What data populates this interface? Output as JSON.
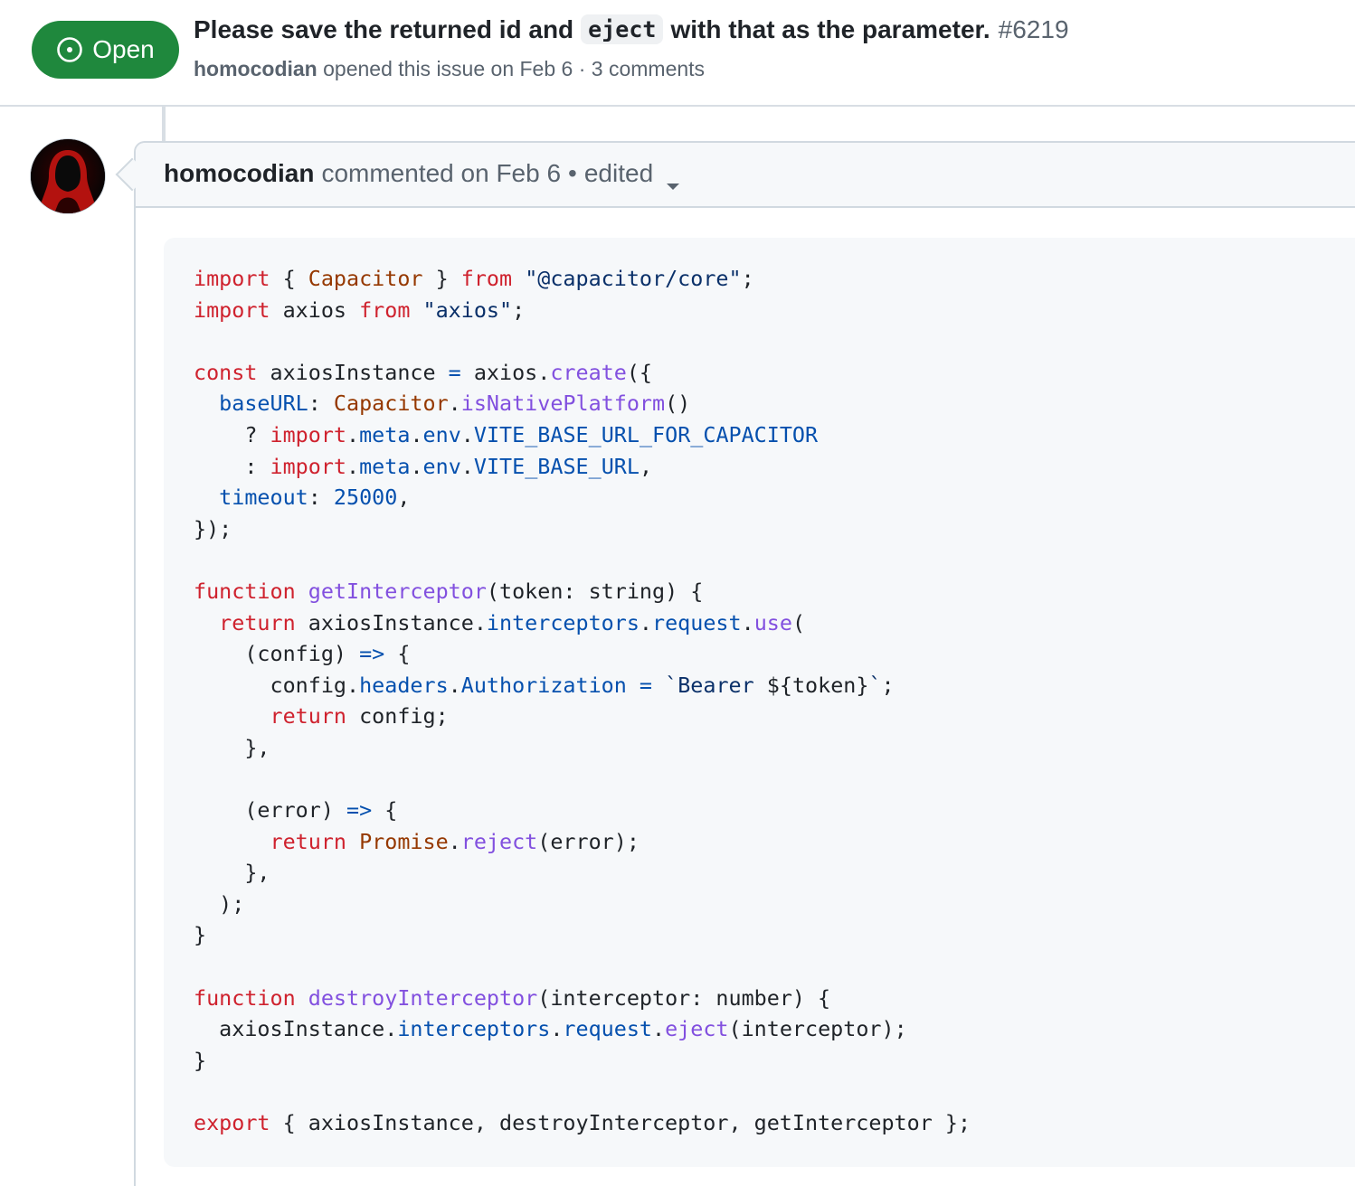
{
  "issue": {
    "state": "Open",
    "title_before": "Please save the returned id and",
    "title_code": "eject",
    "title_after": "with that as the parameter.",
    "number": "#6219",
    "author": "homocodian",
    "opened_text": "opened this issue on Feb 6",
    "separator": "·",
    "comments": "3 comments"
  },
  "comment": {
    "author": "homocodian",
    "commented_text": "commented on Feb 6",
    "bullet": "•",
    "edited": "edited"
  },
  "colors": {
    "open_green": "#1f883d",
    "keyword": "#cf222e",
    "class": "#953800",
    "string": "#0a3069",
    "function": "#8250df",
    "property": "#0550ae"
  },
  "code_lines": [
    [
      [
        "kw",
        "import"
      ],
      [
        "p",
        " { "
      ],
      [
        "cls",
        "Capacitor"
      ],
      [
        "p",
        " } "
      ],
      [
        "kw",
        "from"
      ],
      [
        "p",
        " "
      ],
      [
        "str",
        "\"@capacitor/core\""
      ],
      [
        "p",
        ";"
      ]
    ],
    [
      [
        "kw",
        "import"
      ],
      [
        "p",
        " axios "
      ],
      [
        "kw",
        "from"
      ],
      [
        "p",
        " "
      ],
      [
        "str",
        "\"axios\""
      ],
      [
        "p",
        ";"
      ]
    ],
    [],
    [
      [
        "kw",
        "const"
      ],
      [
        "p",
        " axiosInstance "
      ],
      [
        "prop",
        "="
      ],
      [
        "p",
        " axios."
      ],
      [
        "fn",
        "create"
      ],
      [
        "p",
        "({"
      ]
    ],
    [
      [
        "p",
        "  "
      ],
      [
        "prop",
        "baseURL"
      ],
      [
        "p",
        ": "
      ],
      [
        "cls",
        "Capacitor"
      ],
      [
        "p",
        "."
      ],
      [
        "fn",
        "isNativePlatform"
      ],
      [
        "p",
        "()"
      ]
    ],
    [
      [
        "p",
        "    ? "
      ],
      [
        "kw",
        "import"
      ],
      [
        "p",
        "."
      ],
      [
        "prop",
        "meta"
      ],
      [
        "p",
        "."
      ],
      [
        "prop",
        "env"
      ],
      [
        "p",
        "."
      ],
      [
        "prop",
        "VITE_BASE_URL_FOR_CAPACITOR"
      ]
    ],
    [
      [
        "p",
        "    : "
      ],
      [
        "kw",
        "import"
      ],
      [
        "p",
        "."
      ],
      [
        "prop",
        "meta"
      ],
      [
        "p",
        "."
      ],
      [
        "prop",
        "env"
      ],
      [
        "p",
        "."
      ],
      [
        "prop",
        "VITE_BASE_URL"
      ],
      [
        "p",
        ","
      ]
    ],
    [
      [
        "p",
        "  "
      ],
      [
        "prop",
        "timeout"
      ],
      [
        "p",
        ": "
      ],
      [
        "prop",
        "25000"
      ],
      [
        "p",
        ","
      ]
    ],
    [
      [
        "p",
        "});"
      ]
    ],
    [],
    [
      [
        "kw",
        "function"
      ],
      [
        "p",
        " "
      ],
      [
        "fn",
        "getInterceptor"
      ],
      [
        "p",
        "(token: string) {"
      ]
    ],
    [
      [
        "p",
        "  "
      ],
      [
        "kw",
        "return"
      ],
      [
        "p",
        " axiosInstance."
      ],
      [
        "prop",
        "interceptors"
      ],
      [
        "p",
        "."
      ],
      [
        "prop",
        "request"
      ],
      [
        "p",
        "."
      ],
      [
        "fn",
        "use"
      ],
      [
        "p",
        "("
      ]
    ],
    [
      [
        "p",
        "    (config) "
      ],
      [
        "prop",
        "=>"
      ],
      [
        "p",
        " {"
      ]
    ],
    [
      [
        "p",
        "      config."
      ],
      [
        "prop",
        "headers"
      ],
      [
        "p",
        "."
      ],
      [
        "prop",
        "Authorization"
      ],
      [
        "p",
        " "
      ],
      [
        "prop",
        "="
      ],
      [
        "p",
        " "
      ],
      [
        "str",
        "`Bearer "
      ],
      [
        "p",
        "${token}"
      ],
      [
        "str",
        "`"
      ],
      [
        "p",
        ";"
      ]
    ],
    [
      [
        "p",
        "      "
      ],
      [
        "kw",
        "return"
      ],
      [
        "p",
        " config;"
      ]
    ],
    [
      [
        "p",
        "    },"
      ]
    ],
    [],
    [
      [
        "p",
        "    (error) "
      ],
      [
        "prop",
        "=>"
      ],
      [
        "p",
        " {"
      ]
    ],
    [
      [
        "p",
        "      "
      ],
      [
        "kw",
        "return"
      ],
      [
        "p",
        " "
      ],
      [
        "cls",
        "Promise"
      ],
      [
        "p",
        "."
      ],
      [
        "fn",
        "reject"
      ],
      [
        "p",
        "(error);"
      ]
    ],
    [
      [
        "p",
        "    },"
      ]
    ],
    [
      [
        "p",
        "  );"
      ]
    ],
    [
      [
        "p",
        "}"
      ]
    ],
    [],
    [
      [
        "kw",
        "function"
      ],
      [
        "p",
        " "
      ],
      [
        "fn",
        "destroyInterceptor"
      ],
      [
        "p",
        "(interceptor: number) {"
      ]
    ],
    [
      [
        "p",
        "  axiosInstance."
      ],
      [
        "prop",
        "interceptors"
      ],
      [
        "p",
        "."
      ],
      [
        "prop",
        "request"
      ],
      [
        "p",
        "."
      ],
      [
        "fn",
        "eject"
      ],
      [
        "p",
        "(interceptor);"
      ]
    ],
    [
      [
        "p",
        "}"
      ]
    ],
    [],
    [
      [
        "kw",
        "export"
      ],
      [
        "p",
        " { axiosInstance, destroyInterceptor, getInterceptor };"
      ]
    ]
  ]
}
